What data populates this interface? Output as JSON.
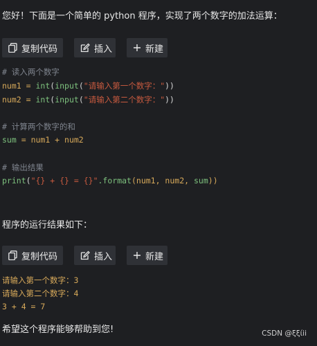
{
  "intro": "您好！下面是一个简单的 python 程序，实现了两个数字的加法运算：",
  "toolbar_1": {
    "copy_label": "复制代码",
    "insert_label": "插入",
    "new_label": "新建"
  },
  "code": {
    "comment1": "# 读入两个数字",
    "line1": {
      "var": "num1",
      "op": " = ",
      "fn1": "int",
      "p1": "(",
      "fn2": "input",
      "p2": "(",
      "str": "\"请输入第一个数字：\"",
      "close": "))"
    },
    "line2": {
      "var": "num2",
      "op": " = ",
      "fn1": "int",
      "p1": "(",
      "fn2": "input",
      "p2": "(",
      "str": "\"请输入第二个数字：\"",
      "close": "))"
    },
    "comment2": "# 计算两个数字的和",
    "line3": {
      "var": "sum",
      "op": " = ",
      "rest": "num1 + num2"
    },
    "comment3": "# 输出结果",
    "line4": {
      "fn": "print",
      "p1": "(",
      "str": "\"{} + {} = {}\"",
      "method": ".format",
      "args_open": "(num1, num2, ",
      "sumvar": "sum",
      "close": "))"
    }
  },
  "result_intro": "程序的运行结果如下：",
  "toolbar_2": {
    "copy_label": "复制代码",
    "insert_label": "插入",
    "new_label": "新建"
  },
  "output": {
    "line1": "请输入第一个数字：3",
    "line2": "请输入第二个数字：4",
    "line3": "3 + 4 = 7"
  },
  "closing": "希望这个程序能够帮助到您!",
  "watermark": "CSDN @ξξίii",
  "colors": {
    "background": "#1e1f22",
    "button_bg": "#2f3136",
    "comment": "#7f848e",
    "variable": "#d7a95a",
    "function": "#7ec27e",
    "string": "#c85a3f"
  },
  "icons": [
    "copy-icon",
    "edit-icon",
    "plus-icon"
  ]
}
